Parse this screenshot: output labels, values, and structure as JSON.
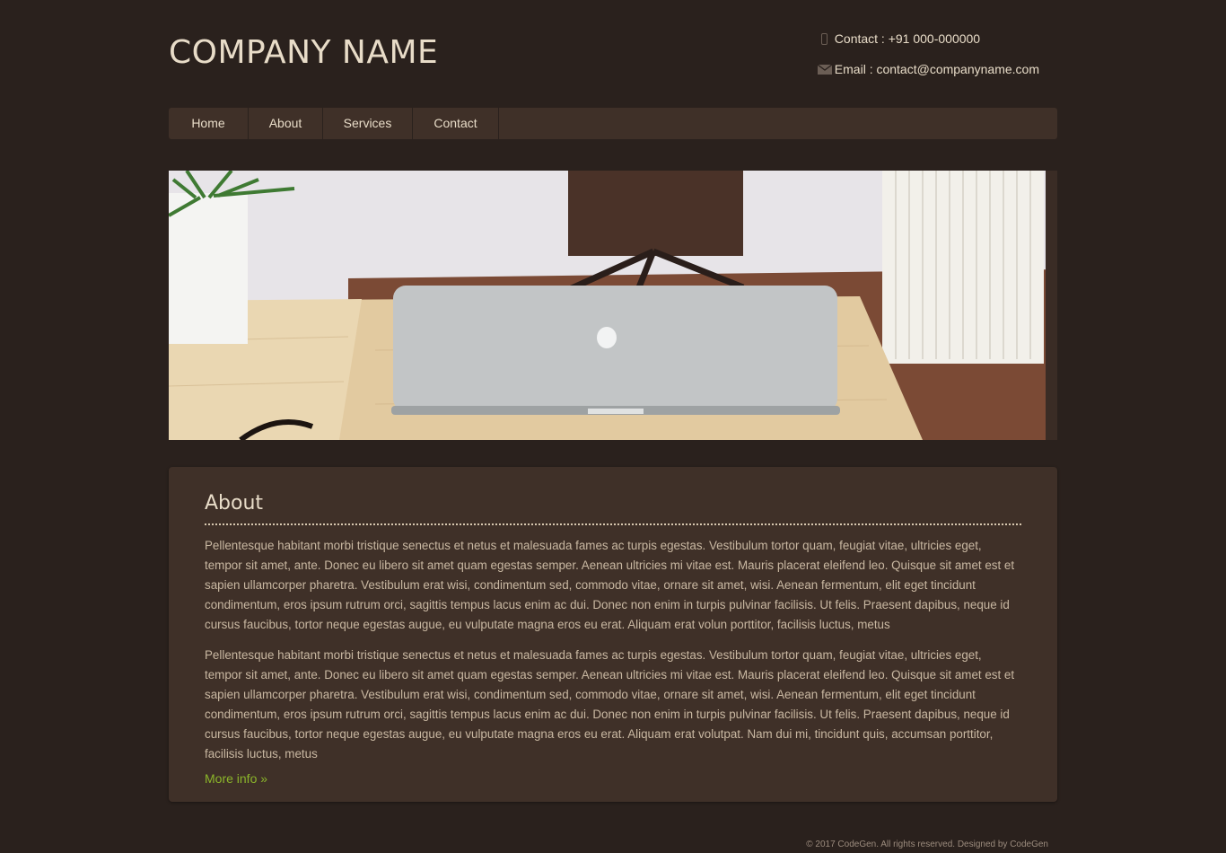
{
  "header": {
    "brand": "COMPANY NAME",
    "contact_phone": "Contact : +91 000-000000",
    "contact_email": "Email : contact@companyname.com"
  },
  "nav": {
    "items": [
      {
        "label": "Home"
      },
      {
        "label": "About"
      },
      {
        "label": "Services"
      },
      {
        "label": "Contact"
      }
    ]
  },
  "hero": {
    "description": "Desk scene with laptop and plant"
  },
  "about": {
    "title": "About",
    "paragraph_1": "Pellentesque habitant morbi tristique senectus et netus et malesuada fames ac turpis egestas. Vestibulum tortor quam, feugiat vitae, ultricies eget, tempor sit amet, ante. Donec eu libero sit amet quam egestas semper. Aenean ultricies mi vitae est. Mauris placerat eleifend leo. Quisque sit amet est et sapien ullamcorper pharetra. Vestibulum erat wisi, condimentum sed, commodo vitae, ornare sit amet, wisi. Aenean fermentum, elit eget tincidunt condimentum, eros ipsum rutrum orci, sagittis tempus lacus enim ac dui. Donec non enim in turpis pulvinar facilisis. Ut felis. Praesent dapibus, neque id cursus faucibus, tortor neque egestas augue, eu vulputate magna eros eu erat. Aliquam erat volun porttitor, facilisis luctus, metus",
    "paragraph_2": "Pellentesque habitant morbi tristique senectus et netus et malesuada fames ac turpis egestas. Vestibulum tortor quam, feugiat vitae, ultricies eget, tempor sit amet, ante. Donec eu libero sit amet quam egestas semper. Aenean ultricies mi vitae est. Mauris placerat eleifend leo. Quisque sit amet est et sapien ullamcorper pharetra. Vestibulum erat wisi, condimentum sed, commodo vitae, ornare sit amet, wisi. Aenean fermentum, elit eget tincidunt condimentum, eros ipsum rutrum orci, sagittis tempus lacus enim ac dui. Donec non enim in turpis pulvinar facilisis. Ut felis. Praesent dapibus, neque id cursus faucibus, tortor neque egestas augue, eu vulputate magna eros eu erat. Aliquam erat volutpat. Nam dui mi, tincidunt quis, accumsan porttitor, facilisis luctus, metus",
    "more_link": "More info »"
  },
  "footer": {
    "text": "© 2017 CodeGen. All rights reserved. Designed by CodeGen"
  },
  "colors": {
    "background": "#2a211d",
    "panel": "#3f3028",
    "link": "#8bb52a"
  }
}
